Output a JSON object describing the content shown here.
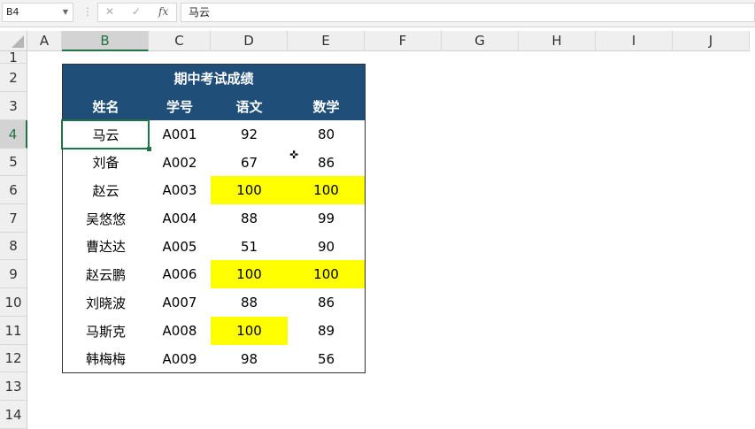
{
  "name_box": "B4",
  "formula_bar": {
    "cancel": "✕",
    "enter": "✓",
    "fx": "fx",
    "value": "马云"
  },
  "columns": [
    "A",
    "B",
    "C",
    "D",
    "E",
    "F",
    "G",
    "H",
    "I",
    "J"
  ],
  "rows": [
    "1",
    "2",
    "3",
    "4",
    "5",
    "6",
    "7",
    "8",
    "9",
    "10",
    "11",
    "12",
    "13",
    "14"
  ],
  "table": {
    "title": "期中考试成绩",
    "headers": [
      "姓名",
      "学号",
      "语文",
      "数学"
    ],
    "rows": [
      {
        "name": "马云",
        "id": "A001",
        "chinese": "92",
        "math": "80"
      },
      {
        "name": "刘备",
        "id": "A002",
        "chinese": "67",
        "math": "86"
      },
      {
        "name": "赵云",
        "id": "A003",
        "chinese": "100",
        "math": "100"
      },
      {
        "name": "吴悠悠",
        "id": "A004",
        "chinese": "88",
        "math": "99"
      },
      {
        "name": "曹达达",
        "id": "A005",
        "chinese": "51",
        "math": "90"
      },
      {
        "name": "赵云鹏",
        "id": "A006",
        "chinese": "100",
        "math": "100"
      },
      {
        "name": "刘晓波",
        "id": "A007",
        "chinese": "88",
        "math": "86"
      },
      {
        "name": "马斯克",
        "id": "A008",
        "chinese": "100",
        "math": "89"
      },
      {
        "name": "韩梅梅",
        "id": "A009",
        "chinese": "98",
        "math": "56"
      }
    ]
  },
  "highlight_color": "#ffff00",
  "header_color": "#1f4e79"
}
